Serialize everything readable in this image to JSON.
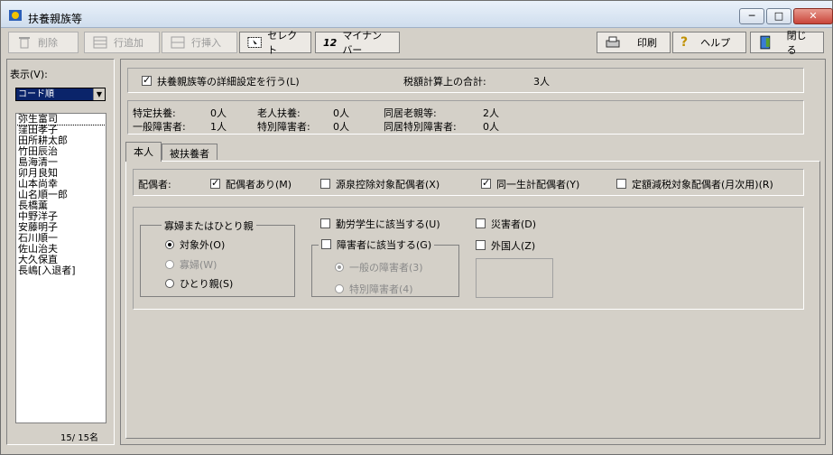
{
  "window": {
    "title": "扶養親族等"
  },
  "toolbar": {
    "delete": "削除",
    "add_row": "行追加",
    "insert_row": "行挿入",
    "select": "セレクト",
    "mynumber": "マイナンバー",
    "print": "印刷",
    "help": "ヘルプ",
    "close": "閉じる"
  },
  "sidebar": {
    "show_label": "表示(V):",
    "order_value": "コード順",
    "names": [
      "弥生富司",
      "窪田孝子",
      "田所耕太郎",
      "竹田辰治",
      "島海清一",
      "卯月良知",
      "山本尚幸",
      "山名順一郎",
      "長橋薫",
      "中野洋子",
      "安藤明子",
      "石川順一",
      "佐山治夫",
      "大久保直",
      "長嶋[入退者]"
    ],
    "count": "15/  15名"
  },
  "summary": {
    "detail_setting": "扶養親族等の詳細設定を行う(L)",
    "tax_total_label": "税額計算上の合計:",
    "tax_total_value": "3人",
    "special_label": "特定扶養:",
    "special_value": "0人",
    "elderly_label": "老人扶養:",
    "elderly_value": "0人",
    "cohabit_elderly_label": "同居老親等:",
    "cohabit_elderly_value": "2人",
    "general_disabled_label": "一般障害者:",
    "general_disabled_value": "1人",
    "special_disabled_label": "特別障害者:",
    "special_disabled_value": "0人",
    "cohabit_special_label": "同居特別障害者:",
    "cohabit_special_value": "0人"
  },
  "tabs": {
    "self": "本人",
    "dependents": "被扶養者"
  },
  "spouse": {
    "label": "配偶者:",
    "has_spouse": "配偶者あり(M)",
    "withholding": "源泉控除対象配偶者(X)",
    "same_household": "同一生計配偶者(Y)",
    "fixed_reduction": "定額減税対象配偶者(月次用)(R)"
  },
  "widow": {
    "group_title": "寡婦またはひとり親",
    "not_applicable": "対象外(O)",
    "widow": "寡婦(W)",
    "single_parent": "ひとり親(S)"
  },
  "flags": {
    "working_student": "勤労学生に該当する(U)",
    "disabled": "障害者に該当する(G)",
    "general_disabled": "一般の障害者(3)",
    "special_disabled": "特別障害者(4)",
    "disaster": "災害者(D)",
    "foreigner": "外国人(Z)"
  },
  "colors": {
    "accent": "#0a246a",
    "face": "#d4d0c8"
  }
}
